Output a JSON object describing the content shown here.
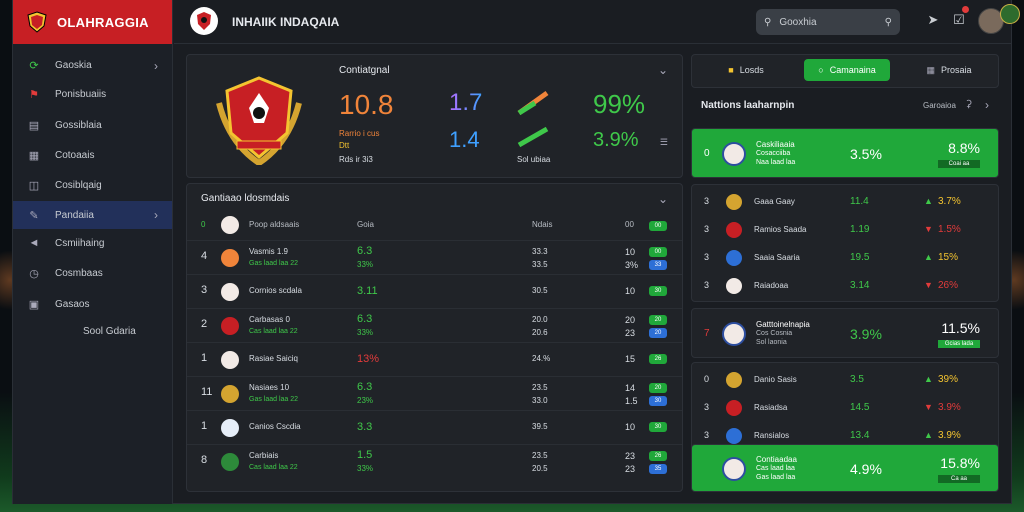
{
  "app": {
    "brand": "OLAHRAGGIA",
    "title": "INHAIIK INDAQAIA"
  },
  "search": {
    "placeholder": "Gooxhia"
  },
  "colors": {
    "brand_red": "#c71f24",
    "accent_green": "#20a83a",
    "nav_active": "#22305a",
    "orange": "#f0843a"
  },
  "sidebar": {
    "items": [
      {
        "label": "Gaoskia",
        "icon": "refresh-icon",
        "chevron": true
      },
      {
        "label": "Ponisbuaiis",
        "icon": "flag-icon"
      },
      {
        "label": "Gossiblaia",
        "icon": "briefcase-icon"
      },
      {
        "label": "Cotoaais",
        "icon": "grid-icon"
      },
      {
        "label": "Cosiblqaig",
        "icon": "book-icon"
      },
      {
        "label": "Pandaiia",
        "icon": "pencil-icon",
        "chevron": true,
        "active": true
      },
      {
        "label": "Csmiihaing",
        "icon": "megaphone-icon"
      },
      {
        "label": "Cosmbaas",
        "icon": "clock-icon"
      },
      {
        "label": "Gasaos",
        "icon": "window-icon"
      },
      {
        "label": "Sool Gdaria",
        "icon": ""
      }
    ]
  },
  "featured": {
    "title": "Contiatgnal",
    "main_stat": "10.8",
    "main_sub1": "Rarrio i cus",
    "main_sub2": "Dtt",
    "main_sub3": "Rds ir 3i3",
    "s2": "1.7",
    "s2b": "1.4",
    "s3_label": "Sol ubiaa",
    "s4": "99%",
    "s4b": "3.9%"
  },
  "table": {
    "title": "Gantiaao ldosmdais",
    "headers": [
      "Poop aldsaais",
      "Goia",
      "Ndais",
      "00"
    ],
    "rows": [
      {
        "rank": "4",
        "name": "Vasmis 1.9",
        "sub": "Gas laad laa 22",
        "v1": "6.3",
        "v1s": "33%",
        "v2": "33.3",
        "v2b": "33.5",
        "v3": "10",
        "v3b": "3%",
        "p1": "00",
        "p2": "33"
      },
      {
        "rank": "3",
        "name": "Cornios scdala",
        "sub": "",
        "v1": "3.11",
        "v1s": "",
        "v2": "30.5",
        "v2b": "",
        "v3": "10",
        "v3b": "",
        "p1": "30"
      },
      {
        "rank": "2",
        "name": "Carbasas 0",
        "sub": "Cas laad laa 22",
        "v1": "6.3",
        "v1s": "33%",
        "v2": "20.0",
        "v2b": "20.6",
        "v3": "20",
        "v3b": "23",
        "p1": "20",
        "p2": "20"
      },
      {
        "rank": "1",
        "name": "Rasiae Saiciq",
        "sub": "",
        "v1": "13%",
        "v1s": "",
        "v2": "24.%",
        "v2b": "",
        "v3": "15",
        "v3b": "",
        "p1": "26"
      },
      {
        "rank": "11",
        "name": "Nasiaes 10",
        "sub": "Gas laad laa 22",
        "v1": "6.3",
        "v1s": "23%",
        "v2": "23.5",
        "v2b": "33.0",
        "v3": "14",
        "v3b": "1.5",
        "p1": "20",
        "p2": "30"
      },
      {
        "rank": "1",
        "name": "Canios Cscdia",
        "sub": "",
        "v1": "3.3",
        "v1s": "",
        "v2": "39.5",
        "v2b": "",
        "v3": "10",
        "v3b": "",
        "p1": "30"
      },
      {
        "rank": "8",
        "name": "Carbiais",
        "sub": "Cas laad laa 22",
        "v1": "1.5",
        "v1s": "33%",
        "v2": "23.5",
        "v2b": "20.5",
        "v3": "23",
        "v3b": "23",
        "p1": "26",
        "p2": "35"
      }
    ]
  },
  "right": {
    "tabs": [
      "Losds",
      "Camanaina",
      "Prosaia"
    ],
    "title": "Nattions laaharnpin",
    "filter": "Garoaioa",
    "highlight1": {
      "rank": "0",
      "name": "Caskiliaaia",
      "sub": "Cosacciiba",
      "sub2": "Naa laad laa",
      "v": "3.5%",
      "v2": "8.8%",
      "bar": "Coai aa"
    },
    "rows1": [
      {
        "rank": "3",
        "name": "Gaaa Gaay",
        "v": "11.4",
        "c": "3.7%"
      },
      {
        "rank": "3",
        "name": "Ramios Saada",
        "v": "1.19",
        "c": "1.5%"
      },
      {
        "rank": "3",
        "name": "Saaia Saaria",
        "v": "19.5",
        "c": "15%"
      },
      {
        "rank": "3",
        "name": "Raiadoaa",
        "v": "3.14",
        "c": "26%"
      }
    ],
    "highlight2": {
      "rank": "7",
      "name": "Gatttoinelnapia",
      "sub": "Cos Cosnia",
      "sub2": "Sol laonia",
      "v": "3.9%",
      "v2": "11.5%",
      "bar": "Gcias lada"
    },
    "rows2": [
      {
        "rank": "0",
        "name": "Danio Sasis",
        "v": "3.5",
        "c": "39%"
      },
      {
        "rank": "3",
        "name": "Rasiadsa",
        "v": "14.5",
        "c": "3.9%"
      },
      {
        "rank": "3",
        "name": "Ransialos",
        "v": "13.4",
        "c": "3.9%"
      }
    ],
    "highlight3": {
      "name": "Contiaadaa",
      "sub": "Cas laad laa",
      "sub2": "Gas laad laa",
      "v": "4.9%",
      "v2": "15.8%",
      "bar": "Ca aa"
    }
  }
}
